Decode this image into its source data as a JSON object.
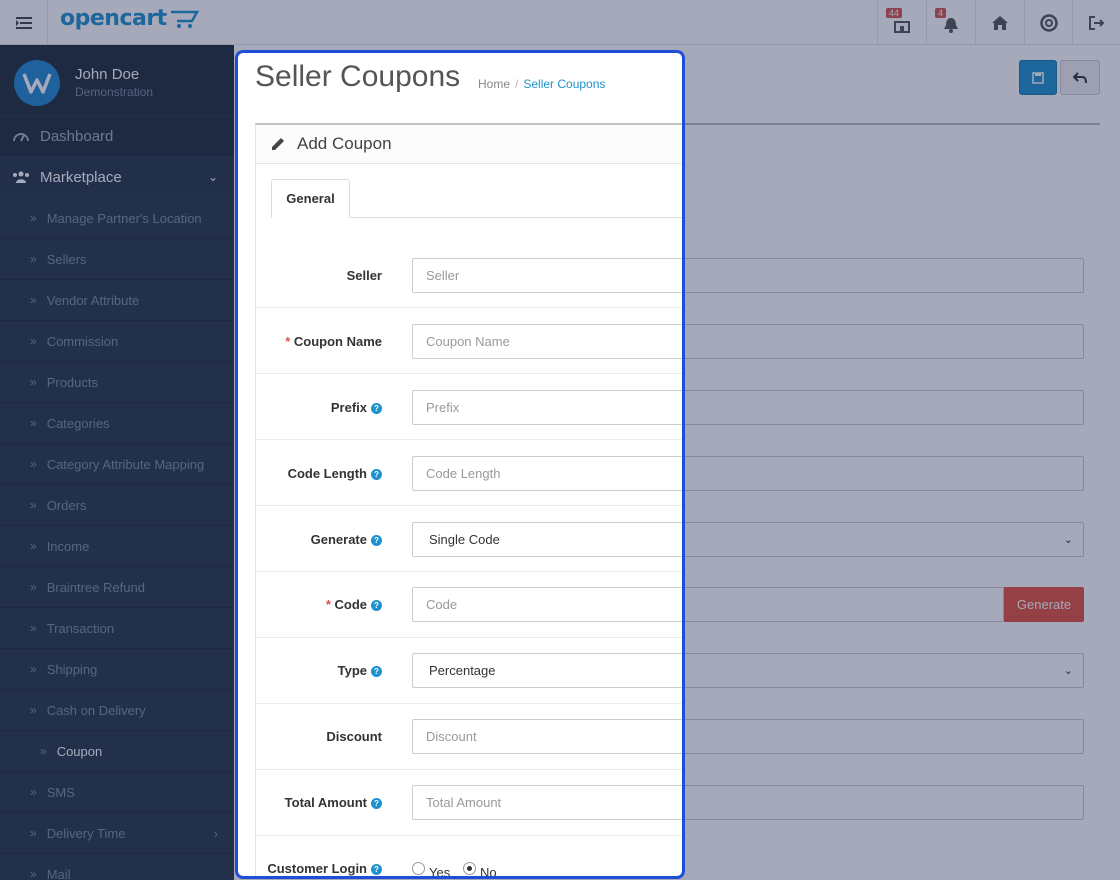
{
  "header": {
    "logo_text": "opencart",
    "store_badge": "44",
    "notification_badge": "4"
  },
  "sidebar": {
    "user_name": "John Doe",
    "user_role": "Demonstration",
    "top_items": [
      {
        "label": "Dashboard"
      },
      {
        "label": "Marketplace"
      }
    ],
    "sub_items": [
      {
        "label": "Manage Partner's Location"
      },
      {
        "label": "Sellers"
      },
      {
        "label": "Vendor Attribute"
      },
      {
        "label": "Commission"
      },
      {
        "label": "Products"
      },
      {
        "label": "Categories"
      },
      {
        "label": "Category Attribute Mapping"
      },
      {
        "label": "Orders"
      },
      {
        "label": "Income"
      },
      {
        "label": "Braintree Refund"
      },
      {
        "label": "Transaction"
      },
      {
        "label": "Shipping"
      },
      {
        "label": "Cash on Delivery"
      },
      {
        "label": "Coupon"
      },
      {
        "label": "SMS"
      },
      {
        "label": "Delivery Time"
      },
      {
        "label": "Mail"
      }
    ]
  },
  "page": {
    "title": "Seller Coupons",
    "breadcrumb": [
      "Home",
      "Seller Coupons"
    ],
    "panel_title": "Add Coupon",
    "tab_general": "General"
  },
  "form": {
    "seller": {
      "label": "Seller",
      "placeholder": "Seller"
    },
    "coupon_name": {
      "required": "*",
      "label": "Coupon Name",
      "placeholder": "Coupon Name"
    },
    "prefix": {
      "label": "Prefix",
      "placeholder": "Prefix"
    },
    "code_length": {
      "label": "Code Length",
      "placeholder": "Code Length"
    },
    "generate": {
      "label": "Generate",
      "value": "Single Code"
    },
    "code": {
      "required": "*",
      "label": "Code",
      "placeholder": "Code",
      "button": "Generate"
    },
    "type": {
      "label": "Type",
      "value": "Percentage"
    },
    "discount": {
      "label": "Discount",
      "placeholder": "Discount"
    },
    "total_amount": {
      "label": "Total Amount",
      "placeholder": "Total Amount"
    },
    "customer_login": {
      "label": "Customer Login",
      "yes": "Yes",
      "no": "No",
      "selected": "No"
    }
  },
  "colors": {
    "accent": "#1e91cf",
    "sidebar_bg": "#1f2b3a",
    "danger": "#e3503e",
    "highlight_border": "#1d4ed8"
  }
}
